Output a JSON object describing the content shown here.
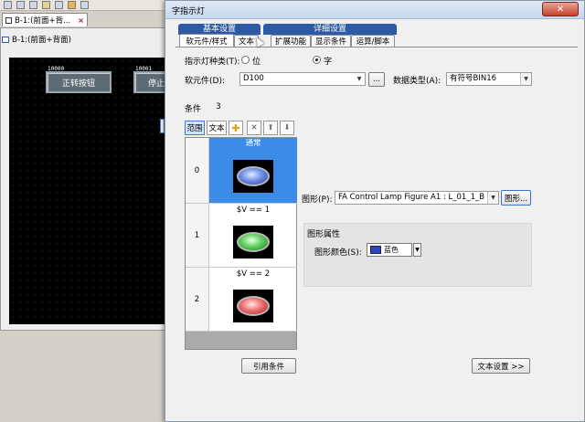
{
  "window": {
    "tab_title": "B-1:(前面+背...",
    "screen_title": "B-1:(前面+背面)",
    "close_glyph": "×"
  },
  "screen": {
    "buttons": [
      {
        "label": "正转按钮",
        "tag": "10000"
      },
      {
        "label": "停止",
        "tag": "10001"
      }
    ]
  },
  "dialog": {
    "title": "字指示灯",
    "close_glyph": "✕",
    "groups": {
      "basic": "基本设置",
      "detail": "详细设置"
    },
    "tabs": [
      "软元件/样式",
      "文本",
      "扩展功能",
      "显示条件",
      "运算/脚本"
    ],
    "active_tab": "软元件/样式",
    "lamp_type": {
      "label": "指示灯种类(T):",
      "options": [
        "位",
        "字"
      ],
      "selected": "字"
    },
    "device": {
      "label": "软元件(D):",
      "value": "D100",
      "browse": "..."
    },
    "data_type": {
      "label": "数据类型(A):",
      "value": "有符号BIN16"
    },
    "condition": {
      "label": "条件",
      "count": "3"
    },
    "toolbar": {
      "range": "范围",
      "text": "文本"
    },
    "list": {
      "header": "通常",
      "rows": [
        {
          "index": "0",
          "condition": "",
          "lamp_color": "#6f8fe6"
        },
        {
          "index": "1",
          "condition": "$V == 1",
          "lamp_color": "#60d060"
        },
        {
          "index": "2",
          "condition": "$V == 2",
          "lamp_color": "#ee7070"
        }
      ]
    },
    "figure": {
      "label": "图形(P):",
      "value": "FA Control Lamp Figure A1 : L_01_1_B",
      "button": "图形..."
    },
    "figure_attr": {
      "title": "图形属性",
      "color_label": "图形颜色(S):",
      "color_name": "蓝色",
      "color": "#2b44c8"
    },
    "buttons": {
      "ref_condition": "引用条件",
      "text_settings": "文本设置 >>"
    }
  }
}
